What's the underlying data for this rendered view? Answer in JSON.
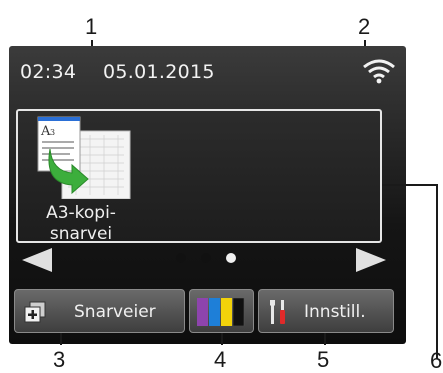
{
  "callouts": {
    "c1": "1",
    "c2": "2",
    "c3": "3",
    "c4": "4",
    "c5": "5",
    "c6": "6"
  },
  "status_bar": {
    "time": "02:34",
    "date": "05.01.2015",
    "wifi_icon": "wifi-icon"
  },
  "shortcut": {
    "label_line1": "A3-kopi-",
    "label_line2": "snarvei",
    "icon": "a3-copy-icon"
  },
  "pager": {
    "pages": 3,
    "active_page": 3,
    "prev_icon": "arrow-left-icon",
    "next_icon": "arrow-right-icon"
  },
  "buttons": {
    "shortcuts_label": "Snarveier",
    "shortcuts_icon": "add-shortcut-icon",
    "ink_icon": "ink-cartridges-icon",
    "settings_label": "Innstill.",
    "settings_icon": "tools-icon"
  },
  "colors": {
    "ink_magenta": "#8e44ad",
    "ink_cyan": "#1e7fd8",
    "ink_yellow": "#f2d20a",
    "ink_black": "#111111"
  }
}
